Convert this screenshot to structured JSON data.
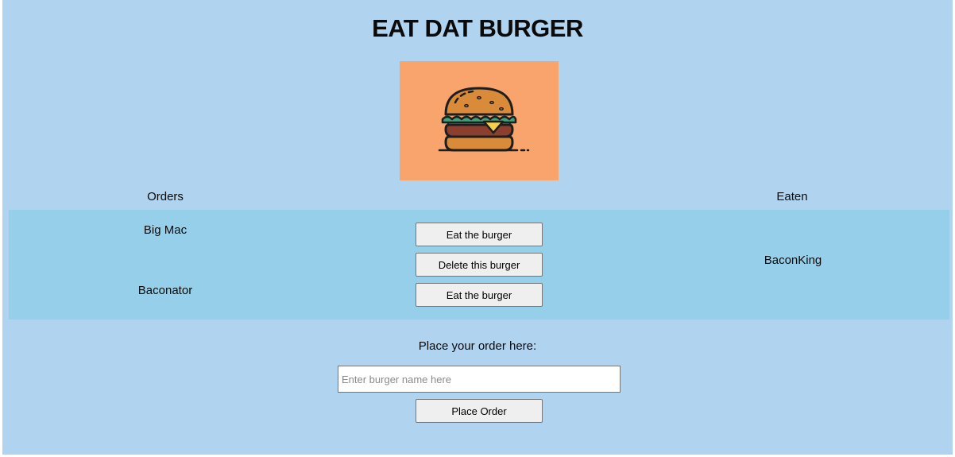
{
  "header": {
    "title": "EAT DAT BURGER"
  },
  "logo": {
    "icon": "burger-icon",
    "background": "#f8a46c"
  },
  "columns": {
    "orders_label": "Orders",
    "eaten_label": "Eaten"
  },
  "orders": [
    {
      "name": "Big Mac",
      "eat_label": "Eat the burger"
    },
    {
      "name": "Baconator",
      "eat_label": "Eat the burger"
    }
  ],
  "eaten": [
    {
      "name": "BaconKing",
      "delete_label": "Delete this burger"
    }
  ],
  "form": {
    "label": "Place your order here:",
    "input_value": "",
    "placeholder": "Enter burger name here",
    "submit_label": "Place Order"
  },
  "colors": {
    "page_background": "#b0d3ef",
    "band_background": "#96cfea",
    "logo_background": "#f8a46c"
  }
}
